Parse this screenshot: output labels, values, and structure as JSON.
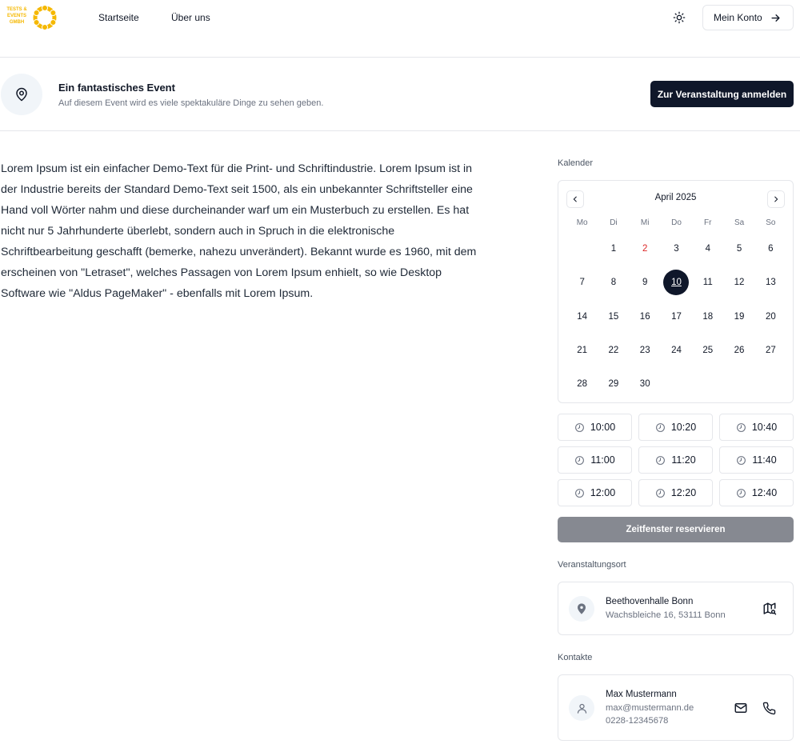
{
  "header": {
    "logo_text": "TESTS & EVENTS GMBH",
    "nav": [
      "Startseite",
      "Über uns"
    ],
    "account_label": "Mein Konto"
  },
  "event": {
    "title": "Ein fantastisches Event",
    "subtitle": "Auf diesem Event wird es viele spektakuläre Dinge zu sehen geben.",
    "register_label": "Zur Veranstaltung anmelden"
  },
  "body_text": "Lorem Ipsum ist ein einfacher Demo-Text für die Print- und Schriftindustrie. Lorem Ipsum ist in der Industrie bereits der Standard Demo-Text seit 1500, als ein unbekannter Schriftsteller eine Hand voll Wörter nahm und diese durcheinander warf um ein Musterbuch zu erstellen. Es hat nicht nur 5 Jahrhunderte überlebt, sondern auch in Spruch in die elektronische Schriftbearbeitung geschafft (bemerke, nahezu unverändert). Bekannt wurde es 1960, mit dem erscheinen von \"Letraset\", welches Passagen von Lorem Ipsum enhielt, so wie Desktop Software wie \"Aldus PageMaker\" - ebenfalls mit Lorem Ipsum.",
  "calendar": {
    "label": "Kalender",
    "month": "April 2025",
    "weekdays": [
      "Mo",
      "Di",
      "Mi",
      "Do",
      "Fr",
      "Sa",
      "So"
    ],
    "first_day_offset": 1,
    "days": [
      "1",
      "2",
      "3",
      "4",
      "5",
      "6",
      "7",
      "8",
      "9",
      "10",
      "11",
      "12",
      "13",
      "14",
      "15",
      "16",
      "17",
      "18",
      "19",
      "20",
      "21",
      "22",
      "23",
      "24",
      "25",
      "26",
      "27",
      "28",
      "29",
      "30"
    ],
    "today": "2",
    "selected": "10"
  },
  "time_slots": [
    "10:00",
    "10:20",
    "10:40",
    "11:00",
    "11:20",
    "11:40",
    "12:00",
    "12:20",
    "12:40"
  ],
  "reserve_label": "Zeitfenster reservieren",
  "venue": {
    "label": "Veranstaltungsort",
    "name": "Beethovenhalle Bonn",
    "address": "Wachsbleiche 16, 53111 Bonn"
  },
  "contacts": {
    "label": "Kontakte",
    "name": "Max Mustermann",
    "email": "max@mustermann.de",
    "phone": "0228-12345678"
  },
  "colors": {
    "primary": "#0f172a",
    "reserve_disabled": "#868991",
    "today": "#dc2626",
    "logo": "#f5b800"
  }
}
